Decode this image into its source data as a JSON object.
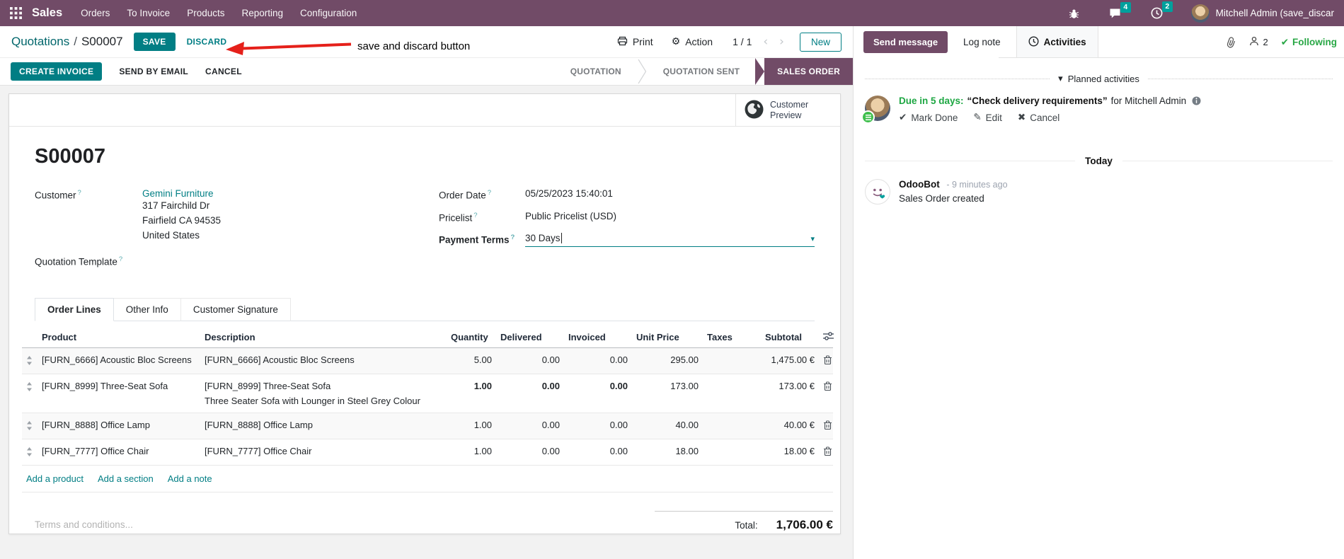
{
  "colors": {
    "primary_teal": "#017E84",
    "brand_purple": "#714B67",
    "badge_teal": "#00A09D",
    "edited_blue": "#0B8EC6",
    "success_green": "#28a745",
    "due_green": "#1EA743",
    "annotation_red": "#E5201A"
  },
  "icons": {
    "gear": "⚙",
    "caret_down": "▾",
    "chevron_left": "‹",
    "chevron_right": "›",
    "check": "✔",
    "pencil": "✎",
    "cross": "✖",
    "collapse_caret": "▾"
  },
  "nav": {
    "app_name": "Sales",
    "menus": [
      "Orders",
      "To Invoice",
      "Products",
      "Reporting",
      "Configuration"
    ],
    "message_badge": "4",
    "activity_badge": "2",
    "user_name": "Mitchell Admin (save_discar"
  },
  "breadcrumb": {
    "parent": "Quotations",
    "separator": "/",
    "current": "S00007"
  },
  "control_panel": {
    "save_label": "SAVE",
    "discard_label": "DISCARD",
    "annotation": "save and discard button",
    "print_label": "Print",
    "action_label": "Action",
    "pager": "1 / 1",
    "new_label": "New"
  },
  "action_buttons": {
    "create_invoice": "CREATE INVOICE",
    "send_by_email": "SEND BY EMAIL",
    "cancel": "CANCEL"
  },
  "statusbar": {
    "stages": [
      "QUOTATION",
      "QUOTATION SENT",
      "SALES ORDER"
    ],
    "active": "SALES ORDER"
  },
  "sheet": {
    "help_marker": "?",
    "smart_button_label": "Customer Preview",
    "title": "S00007",
    "customer_label": "Customer",
    "customer_name": "Gemini Furniture",
    "address": [
      "317 Fairchild Dr",
      "Fairfield CA 94535",
      "United States"
    ],
    "quotation_template_label": "Quotation Template",
    "fields_right": [
      {
        "label": "Order Date",
        "value": "05/25/2023 15:40:01"
      },
      {
        "label": "Pricelist",
        "value": "Public Pricelist (USD)"
      },
      {
        "label": "Payment Terms",
        "value": "30 Days"
      }
    ],
    "tabs": [
      "Order Lines",
      "Other Info",
      "Customer Signature"
    ],
    "active_tab": "Order Lines",
    "table": {
      "headers": [
        "Product",
        "Description",
        "Quantity",
        "Delivered",
        "Invoiced",
        "Unit Price",
        "Taxes",
        "Subtotal"
      ],
      "rows": [
        {
          "product": "[FURN_6666] Acoustic Bloc Screens",
          "description": [
            "[FURN_6666] Acoustic Bloc Screens"
          ],
          "quantity": "5.00",
          "delivered": "0.00",
          "invoiced": "0.00",
          "unit_price": "295.00",
          "taxes": "",
          "subtotal": "1,475.00 €",
          "highlight": false
        },
        {
          "product": "[FURN_8999] Three-Seat Sofa",
          "description": [
            "[FURN_8999] Three-Seat Sofa",
            "Three Seater Sofa with Lounger in Steel Grey Colour"
          ],
          "quantity": "1.00",
          "delivered": "0.00",
          "invoiced": "0.00",
          "unit_price": "173.00",
          "taxes": "",
          "subtotal": "173.00 €",
          "highlight": true
        },
        {
          "product": "[FURN_8888] Office Lamp",
          "description": [
            "[FURN_8888] Office Lamp"
          ],
          "quantity": "1.00",
          "delivered": "0.00",
          "invoiced": "0.00",
          "unit_price": "40.00",
          "taxes": "",
          "subtotal": "40.00 €",
          "highlight": false
        },
        {
          "product": "[FURN_7777] Office Chair",
          "description": [
            "[FURN_7777] Office Chair"
          ],
          "quantity": "1.00",
          "delivered": "0.00",
          "invoiced": "0.00",
          "unit_price": "18.00",
          "taxes": "",
          "subtotal": "18.00 €",
          "highlight": false
        }
      ],
      "footer_links": [
        "Add a product",
        "Add a section",
        "Add a note"
      ]
    },
    "terms_placeholder": "Terms and conditions...",
    "total_label": "Total:",
    "total_value": "1,706.00 €"
  },
  "chatter": {
    "send_message": "Send message",
    "log_note": "Log note",
    "activities": "Activities",
    "follower_count": "2",
    "following": "Following",
    "planned_header": "Planned activities",
    "activity": {
      "due": "Due in 5 days:",
      "title": "“Check delivery requirements”",
      "assignee": "for Mitchell Admin",
      "mark_done": "Mark Done",
      "edit": "Edit",
      "cancel": "Cancel"
    },
    "today": "Today",
    "message": {
      "author": "OdooBot",
      "time": "- 9 minutes ago",
      "body": "Sales Order created"
    }
  }
}
